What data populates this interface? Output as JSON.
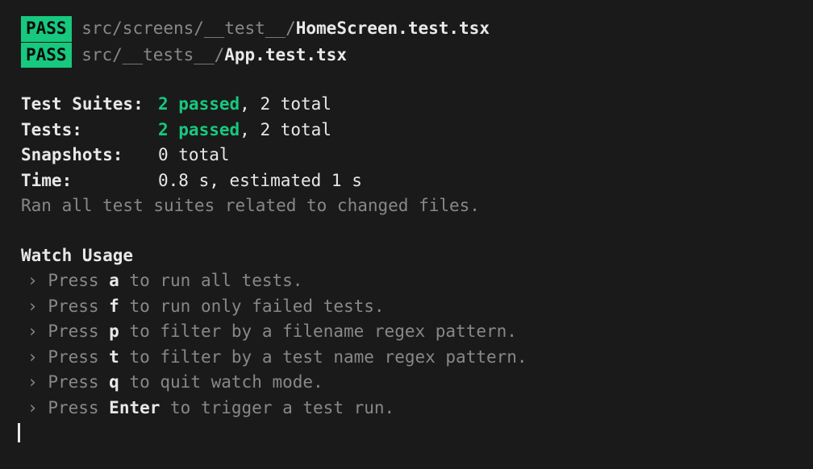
{
  "tests": [
    {
      "badge": "PASS",
      "pathDim": "src/screens/__test__/",
      "pathBold": "HomeScreen.test.tsx"
    },
    {
      "badge": "PASS",
      "pathDim": "src/__tests__/",
      "pathBold": "App.test.tsx"
    }
  ],
  "summary": {
    "testSuites": {
      "label": "Test Suites:",
      "passed": "2 passed",
      "total": ", 2 total"
    },
    "tests": {
      "label": "Tests:",
      "passed": "2 passed",
      "total": ", 2 total"
    },
    "snapshots": {
      "label": "Snapshots:",
      "value": "0 total"
    },
    "time": {
      "label": "Time:",
      "value": "0.8 s, estimated 1 s"
    },
    "ranText": "Ran all test suites related to changed files."
  },
  "watch": {
    "title": "Watch Usage",
    "bullet": "›",
    "press": "Press ",
    "items": [
      {
        "key": "a",
        "desc": " to run all tests."
      },
      {
        "key": "f",
        "desc": " to run only failed tests."
      },
      {
        "key": "p",
        "desc": " to filter by a filename regex pattern."
      },
      {
        "key": "t",
        "desc": " to filter by a test name regex pattern."
      },
      {
        "key": "q",
        "desc": " to quit watch mode."
      },
      {
        "key": "Enter",
        "desc": " to trigger a test run."
      }
    ]
  }
}
